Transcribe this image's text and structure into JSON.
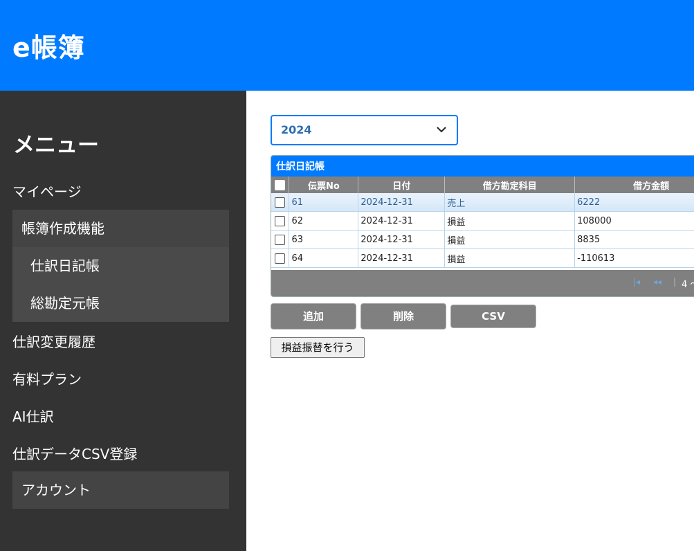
{
  "app": {
    "title": "e帳簿"
  },
  "sidebar": {
    "heading": "メニュー",
    "items": [
      {
        "label": "マイページ"
      },
      {
        "label": "帳簿作成機能"
      },
      {
        "label": "仕訳日記帳"
      },
      {
        "label": "総勘定元帳"
      },
      {
        "label": "仕訳変更履歴"
      },
      {
        "label": "有料プラン"
      },
      {
        "label": "AI仕訳"
      },
      {
        "label": "仕訳データCSV登録"
      },
      {
        "label": "アカウント"
      }
    ]
  },
  "year_select": {
    "value": "2024"
  },
  "grid": {
    "title": "仕訳日記帳",
    "columns": [
      "伝票No",
      "日付",
      "借方勘定科目",
      "借方金額"
    ],
    "rows": [
      {
        "no": "61",
        "date": "2024-12-31",
        "account": "売上",
        "amount": "6222",
        "selected": true
      },
      {
        "no": "62",
        "date": "2024-12-31",
        "account": "損益",
        "amount": "108000",
        "selected": false
      },
      {
        "no": "63",
        "date": "2024-12-31",
        "account": "損益",
        "amount": "8835",
        "selected": false
      },
      {
        "no": "64",
        "date": "2024-12-31",
        "account": "損益",
        "amount": "-110613",
        "selected": false
      }
    ],
    "pager_info": "4 ～"
  },
  "buttons": {
    "add": "追加",
    "delete": "削除",
    "csv": "CSV",
    "transfer": "損益振替を行う"
  },
  "colors": {
    "accent": "#007bff",
    "sidebar": "#333333",
    "grid_header": "#808080"
  }
}
